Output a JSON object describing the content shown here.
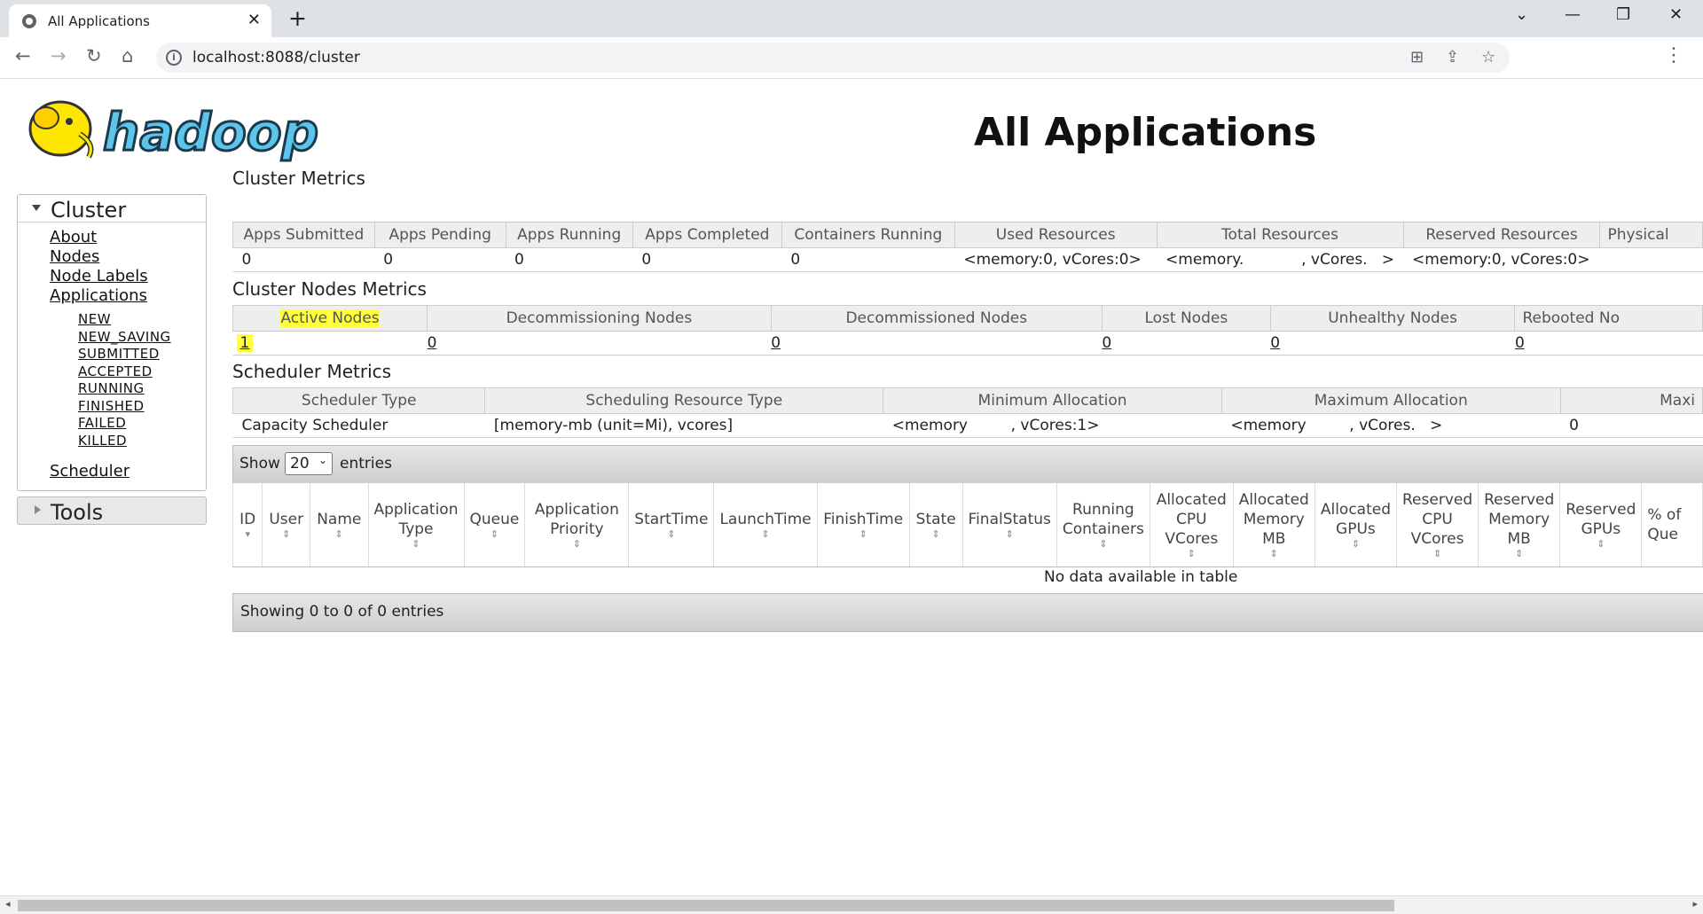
{
  "browser": {
    "tab_title": "All Applications",
    "url_text": "localhost:8088/cluster",
    "new_tab": "+",
    "tab_close": "✕",
    "minimize": "—",
    "maximize": "❐",
    "close": "✕",
    "back": "←",
    "forward": "→",
    "reload": "↻",
    "home": "⌂",
    "translate": "⊞",
    "share": "⇪",
    "bookmark": "☆",
    "menu": "⋮",
    "tabs_dropdown": "⌄"
  },
  "header": {
    "logo_text": "hadoop",
    "title": "All Applications"
  },
  "nav": {
    "cluster_label": "Cluster",
    "cluster_links": [
      "About",
      "Nodes",
      "Node Labels",
      "Applications"
    ],
    "app_states": [
      "NEW",
      "NEW_SAVING",
      "SUBMITTED",
      "ACCEPTED",
      "RUNNING",
      "FINISHED",
      "FAILED",
      "KILLED"
    ],
    "scheduler_label": "Scheduler",
    "tools_label": "Tools"
  },
  "cluster_metrics": {
    "title": "Cluster Metrics",
    "headers": [
      "Apps Submitted",
      "Apps Pending",
      "Apps Running",
      "Apps Completed",
      "Containers Running",
      "Used Resources",
      "Total Resources",
      "Reserved Resources",
      "Physical"
    ],
    "values": [
      "0",
      "0",
      "0",
      "0",
      "0",
      "<memory:0, vCores:0>",
      "<memory.            , vCores.   >",
      "<memory:0, vCores:0>",
      ""
    ]
  },
  "nodes_metrics": {
    "title": "Cluster Nodes Metrics",
    "headers": [
      "Active Nodes",
      "Decommissioning Nodes",
      "Decommissioned Nodes",
      "Lost Nodes",
      "Unhealthy Nodes",
      "Rebooted No"
    ],
    "values": [
      "1",
      "0",
      "0",
      "0",
      "0",
      "0"
    ]
  },
  "scheduler_metrics": {
    "title": "Scheduler Metrics",
    "headers": [
      "Scheduler Type",
      "Scheduling Resource Type",
      "Minimum Allocation",
      "Maximum Allocation",
      "Maxi"
    ],
    "values": [
      "Capacity Scheduler",
      "[memory-mb (unit=Mi), vcores]",
      "<memory         , vCores:1>",
      "<memory         , vCores.   >",
      "0"
    ]
  },
  "show_entries": {
    "show_label": "Show",
    "selected": "20",
    "entries_label": "entries"
  },
  "apps_table": {
    "columns": [
      "ID",
      "User",
      "Name",
      "Application Type",
      "Queue",
      "Application Priority",
      "StartTime",
      "LaunchTime",
      "FinishTime",
      "State",
      "FinalStatus",
      "Running Containers",
      "Allocated CPU VCores",
      "Allocated Memory MB",
      "Allocated GPUs",
      "Reserved CPU VCores",
      "Reserved Memory MB",
      "Reserved GPUs",
      "% of Que"
    ],
    "empty_message": "No data available in table",
    "info": "Showing 0 to 0 of 0 entries"
  },
  "colors": {
    "highlight": "#ffff3a",
    "header_bg": "#eeeeee",
    "logo_yellow": "#ffe600",
    "logo_blue": "#5ec4ea"
  }
}
